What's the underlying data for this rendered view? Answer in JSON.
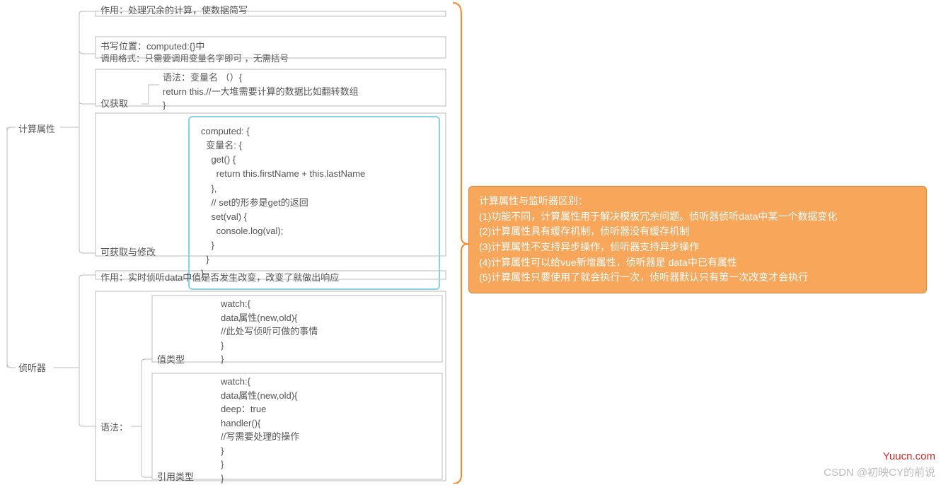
{
  "root": {
    "branch1": {
      "label": "计算属性",
      "n1": "作用：处理冗余的计算，使数据简写",
      "n2_line1": "书写位置：computed:{}中",
      "n2_line2": "调用格式：只需要调用变量名字即可 ，无需括号",
      "n3": {
        "label": "仅获取",
        "code": "语法：变量名 （）{\nreturn this.//一大堆需要计算的数据比如翻转数组\n}"
      },
      "n4": {
        "label": "可获取与修改",
        "code": "computed: {\n  变量名: {\n    get() {\n      return this.firstName + this.lastName\n    },\n    // set的形参是get的返回\n    set(val) {\n      console.log(val);\n    }\n  }\n}"
      }
    },
    "branch2": {
      "label": "侦听器",
      "n1": "作用：实时侦听data中值是否发生改变，改变了就做出响应",
      "n2": {
        "label": "语法：",
        "s1": {
          "label": "值类型",
          "code": "watch:{\ndata属性(new,old){\n//此处写侦听可做的事情\n}\n}"
        },
        "s2": {
          "label": "引用类型",
          "code": "watch:{\ndata属性(new,old){\ndeep：true\nhandler(){\n//写需要处理的操作\n}\n}\n}"
        }
      }
    }
  },
  "info": {
    "title": "计算属性与监听器区别：",
    "l1": "(1)功能不同，计算属性用于解决模板冗余问题。侦听器侦听data中某一个数据变化",
    "l2": "(2)计算属性具有缓存机制，侦听器没有缓存机制",
    "l3": "(3)计算属性不支持异步操作，侦听器支持异步操作",
    "l4": "(4)计算属性可以给vue新增属性，侦听器是 data中已有属性",
    "l5": "(5)计算属性只要使用了就会执行一次，侦听器默认只有第一次改变才会执行"
  },
  "wm1": "Yuucn.com",
  "wm2": "CSDN @初映CY的前说"
}
